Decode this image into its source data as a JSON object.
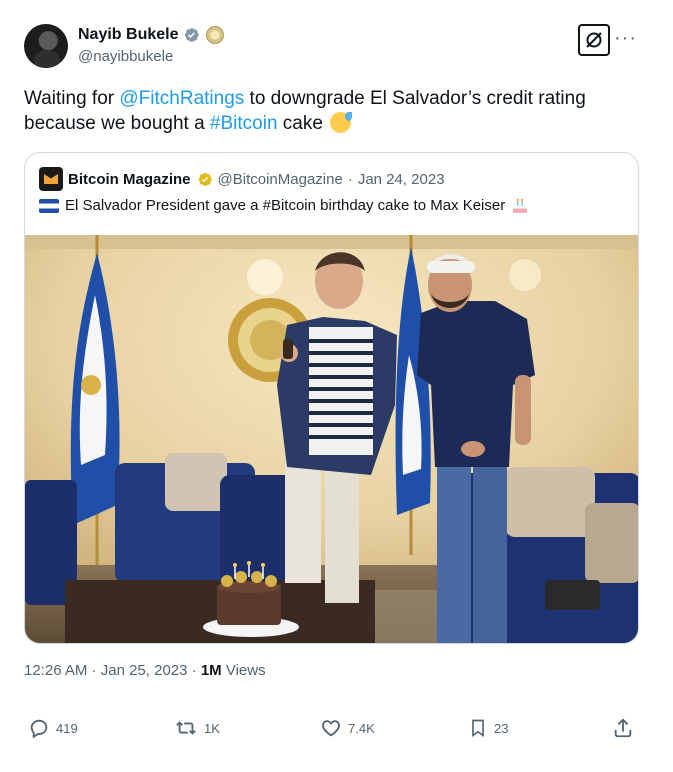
{
  "author": {
    "display_name": "Nayib Bukele",
    "handle": "@nayibbukele"
  },
  "tweet": {
    "text_before_mention": "Waiting for ",
    "mention": "@FitchRatings",
    "text_after_mention": " to downgrade El Salvador’s credit rating because we bought a ",
    "hashtag": "#Bitcoin",
    "text_end": " cake",
    "emoji": "sweat-smile-emoji"
  },
  "quoted_tweet": {
    "display_name": "Bitcoin Magazine",
    "handle": "@BitcoinMagazine",
    "separator": " · ",
    "date": "Jan 24, 2023",
    "flag": "el-salvador-flag-emoji",
    "text": "El Salvador President gave a #Bitcoin birthday cake to Max Keiser",
    "end_emoji": "birthday-cake-emoji"
  },
  "timestamp": {
    "time": "12:26 AM",
    "separator": " · ",
    "date": "Jan 25, 2023",
    "separator2": " · ",
    "views_count": "1M",
    "views_label": " Views"
  },
  "actions": {
    "replies": "419",
    "reposts": "1K",
    "likes": "7.4K",
    "bookmarks": "23"
  },
  "colors": {
    "link": "#1d9bf0",
    "text": "#0f1419",
    "secondary": "#536471",
    "border": "#cfd9de"
  }
}
